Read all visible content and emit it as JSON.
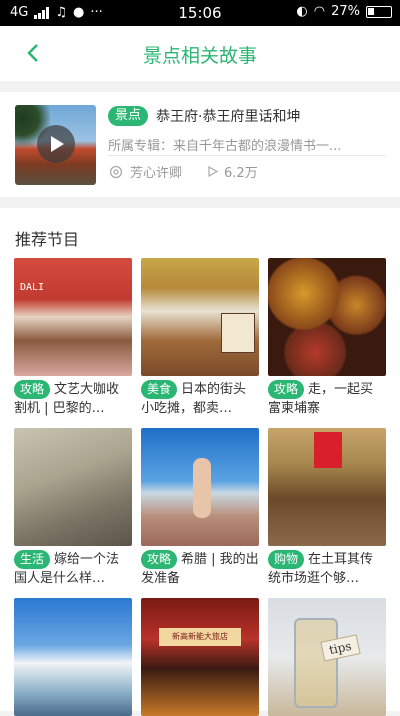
{
  "status_bar": {
    "network": "4G",
    "time": "15:06",
    "battery": "27%"
  },
  "header": {
    "title": "景点相关故事",
    "back_icon": "chevron-left-icon"
  },
  "featured": {
    "tag": "景点",
    "title": "恭王府·恭王府里话和坤",
    "album": "所属专辑：来自千年古都的浪漫情书一...",
    "author": "芳心许卿",
    "plays": "6.2万",
    "accent": "#2bb673"
  },
  "recommend": {
    "title": "推荐节目",
    "items": [
      {
        "tag": "攻略",
        "text": "文艺大咖收割机 | 巴黎的…"
      },
      {
        "tag": "美食",
        "text": "日本的街头小吃摊，都卖…"
      },
      {
        "tag": "攻略",
        "text": "走，一起买富柬埔寨"
      },
      {
        "tag": "生活",
        "text": "嫁给一个法国人是什么样…"
      },
      {
        "tag": "攻略",
        "text": "希腊 | 我的出发准备"
      },
      {
        "tag": "购物",
        "text": "在土耳其传统市场逛个够…"
      },
      {
        "tag": "",
        "text": ""
      },
      {
        "tag": "",
        "text": ""
      },
      {
        "tag": "",
        "text": ""
      }
    ],
    "image_labels": {
      "sign": "DALI",
      "shop_sign": "新高新能大旅店",
      "jar": "tips"
    }
  }
}
